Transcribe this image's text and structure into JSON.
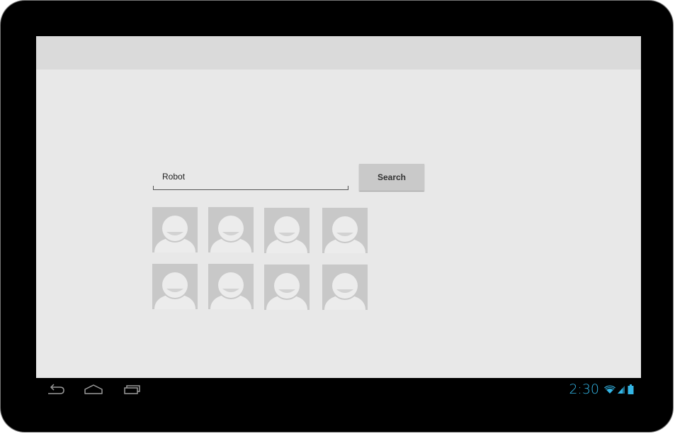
{
  "search": {
    "value": "Robot",
    "button_label": "Search"
  },
  "results": {
    "avatars": [
      {
        "icon": "avatar-placeholder-icon"
      },
      {
        "icon": "avatar-placeholder-icon"
      },
      {
        "icon": "avatar-placeholder-icon"
      },
      {
        "icon": "avatar-placeholder-icon"
      },
      {
        "icon": "avatar-placeholder-icon"
      },
      {
        "icon": "avatar-placeholder-icon"
      },
      {
        "icon": "avatar-placeholder-icon"
      },
      {
        "icon": "avatar-placeholder-icon"
      }
    ]
  },
  "system_bar": {
    "clock": "2:30",
    "nav_icons": [
      "back-icon",
      "home-icon",
      "recent-apps-icon"
    ],
    "status_icons": [
      "wifi-icon",
      "signal-icon",
      "battery-icon"
    ]
  },
  "colors": {
    "accent": "#33b5e5",
    "screen_background": "#e8e8e8",
    "action_bar": "#dadada",
    "button": "#c9c9c9"
  }
}
